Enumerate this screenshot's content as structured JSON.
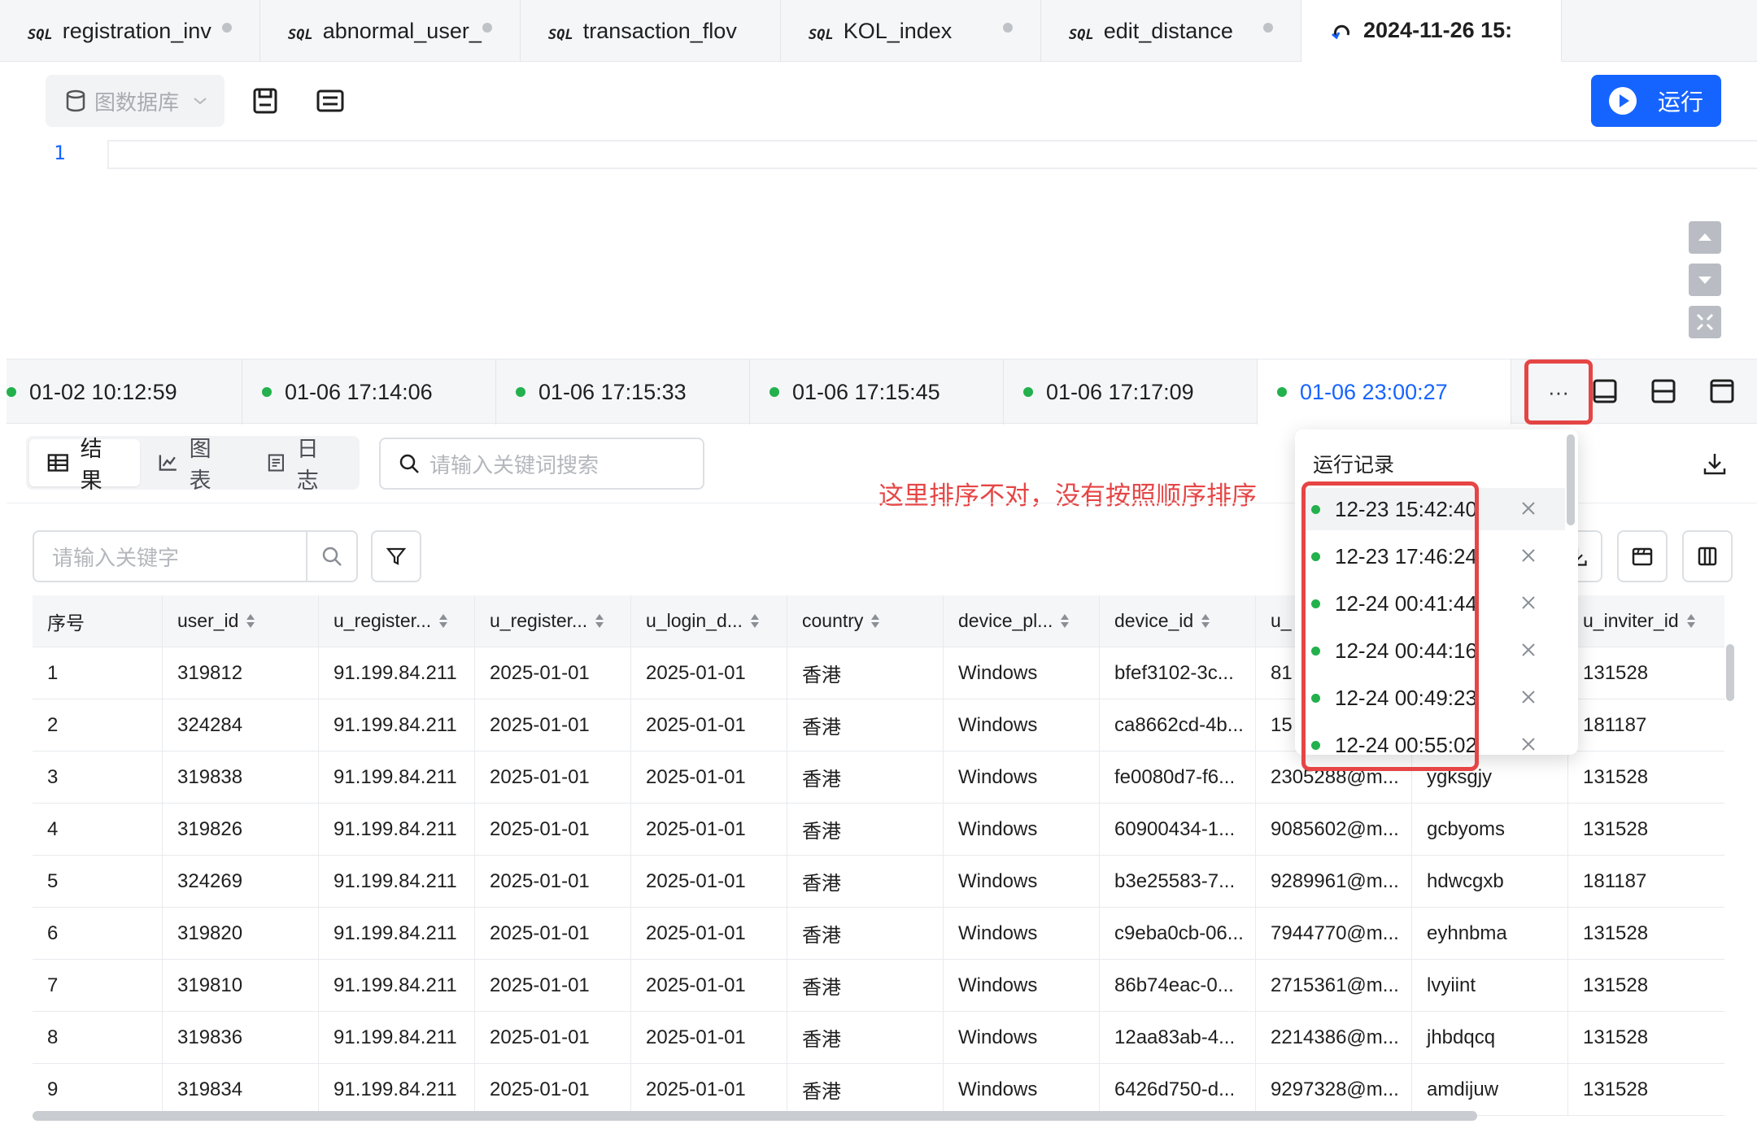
{
  "tabs": [
    {
      "label": "registration_inv",
      "active": false
    },
    {
      "label": "abnormal_user_",
      "active": false
    },
    {
      "label": "transaction_flov",
      "active": false
    },
    {
      "label": "KOL_index",
      "active": false
    },
    {
      "label": "edit_distance",
      "active": false
    },
    {
      "label": "2024-11-26 15:",
      "active": true
    }
  ],
  "sql_mark": "SQL",
  "toolbar": {
    "db_label": "图数据库",
    "run_label": "运行"
  },
  "editor": {
    "line_number": "1"
  },
  "history": {
    "items": [
      "01-02 10:12:59",
      "01-06 17:14:06",
      "01-06 17:15:33",
      "01-06 17:15:45",
      "01-06 17:17:09",
      "01-06 23:00:27"
    ],
    "more_label": "···"
  },
  "view_tabs": {
    "results": "结果",
    "chart": "图表",
    "log": "日志"
  },
  "search": {
    "placeholder": "请输入关键词搜索"
  },
  "filter": {
    "placeholder": "请输入关键字"
  },
  "annotation": "这里排序不对，没有按照顺序排序",
  "popover": {
    "title": "运行记录",
    "records": [
      "12-23 15:42:40",
      "12-23 17:46:24",
      "12-24 00:41:44",
      "12-24 00:44:16",
      "12-24 00:49:23",
      "12-24 00:55:02"
    ]
  },
  "table": {
    "columns": [
      "序号",
      "user_id",
      "u_register...",
      "u_register...",
      "u_login_d...",
      "country",
      "device_pl...",
      "device_id",
      "u_",
      "",
      "u_inviter_id"
    ],
    "rows": [
      [
        "1",
        "319812",
        "91.199.84.211",
        "2025-01-01",
        "2025-01-01",
        "香港",
        "Windows",
        "bfef3102-3c...",
        "81",
        "",
        "131528"
      ],
      [
        "2",
        "324284",
        "91.199.84.211",
        "2025-01-01",
        "2025-01-01",
        "香港",
        "Windows",
        "ca8662cd-4b...",
        "15",
        "",
        "181187"
      ],
      [
        "3",
        "319838",
        "91.199.84.211",
        "2025-01-01",
        "2025-01-01",
        "香港",
        "Windows",
        "fe0080d7-f6...",
        "2305288@m...",
        "ygksgjy",
        "131528"
      ],
      [
        "4",
        "319826",
        "91.199.84.211",
        "2025-01-01",
        "2025-01-01",
        "香港",
        "Windows",
        "60900434-1...",
        "9085602@m...",
        "gcbyoms",
        "131528"
      ],
      [
        "5",
        "324269",
        "91.199.84.211",
        "2025-01-01",
        "2025-01-01",
        "香港",
        "Windows",
        "b3e25583-7...",
        "9289961@m...",
        "hdwcgxb",
        "181187"
      ],
      [
        "6",
        "319820",
        "91.199.84.211",
        "2025-01-01",
        "2025-01-01",
        "香港",
        "Windows",
        "c9eba0cb-06...",
        "7944770@m...",
        "eyhnbma",
        "131528"
      ],
      [
        "7",
        "319810",
        "91.199.84.211",
        "2025-01-01",
        "2025-01-01",
        "香港",
        "Windows",
        "86b74eac-0...",
        "2715361@m...",
        "lvyiint",
        "131528"
      ],
      [
        "8",
        "319836",
        "91.199.84.211",
        "2025-01-01",
        "2025-01-01",
        "香港",
        "Windows",
        "12aa83ab-4...",
        "2214386@m...",
        "jhbdqcq",
        "131528"
      ],
      [
        "9",
        "319834",
        "91.199.84.211",
        "2025-01-01",
        "2025-01-01",
        "香港",
        "Windows",
        "6426d750-d...",
        "9297328@m...",
        "amdijuw",
        "131528"
      ]
    ]
  },
  "colors": {
    "accent": "#1664ff",
    "annotation": "#e64545",
    "status_dot": "#22b14c"
  }
}
